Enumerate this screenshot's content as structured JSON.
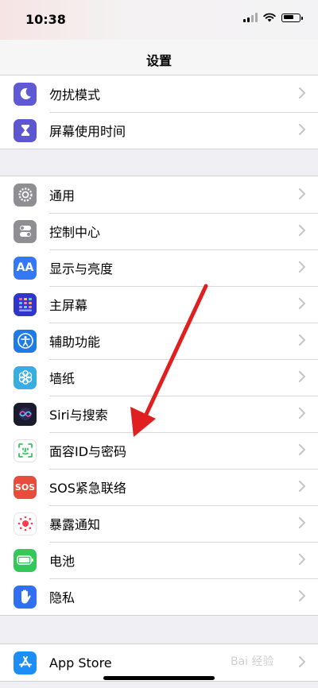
{
  "status": {
    "time": "10:38"
  },
  "nav": {
    "title": "设置"
  },
  "section1": [
    {
      "name": "dnd",
      "label": "勿扰模式",
      "icon": "moon-icon",
      "color": "#5f5ad3"
    },
    {
      "name": "screen-time",
      "label": "屏幕使用时间",
      "icon": "hourglass-icon",
      "color": "#5c57d0"
    }
  ],
  "section2": [
    {
      "name": "general",
      "label": "通用",
      "icon": "gear-icon",
      "color": "#8e8e93"
    },
    {
      "name": "control-center",
      "label": "控制中心",
      "icon": "toggles-icon",
      "color": "#8e8e93"
    },
    {
      "name": "display",
      "label": "显示与亮度",
      "icon": "aa-icon",
      "color": "#3478f6"
    },
    {
      "name": "home-screen",
      "label": "主屏幕",
      "icon": "grid-icon",
      "color": "#3a3ad6"
    },
    {
      "name": "accessibility",
      "label": "辅助功能",
      "icon": "accessibility-icon",
      "color": "#1e7ae6"
    },
    {
      "name": "wallpaper",
      "label": "墙纸",
      "icon": "flower-icon",
      "color": "#38aee0"
    },
    {
      "name": "siri",
      "label": "Siri与搜索",
      "icon": "siri-icon",
      "color": "#222"
    },
    {
      "name": "face-id",
      "label": "面容ID与密码",
      "icon": "face-id-icon",
      "color": "#34c759"
    },
    {
      "name": "sos",
      "label": "SOS紧急联络",
      "icon": "sos-icon",
      "color": "#e74c3c"
    },
    {
      "name": "exposure",
      "label": "暴露通知",
      "icon": "exposure-icon",
      "color": "#ffffff"
    },
    {
      "name": "battery",
      "label": "电池",
      "icon": "battery-icon",
      "color": "#34c759"
    },
    {
      "name": "privacy",
      "label": "隐私",
      "icon": "hand-icon",
      "color": "#2f6ff0"
    }
  ],
  "section3": [
    {
      "name": "app-store",
      "label": "App Store",
      "icon": "app-store-icon",
      "color": "#1c8ef5"
    }
  ],
  "watermark": {
    "text": "Bai 经验"
  }
}
